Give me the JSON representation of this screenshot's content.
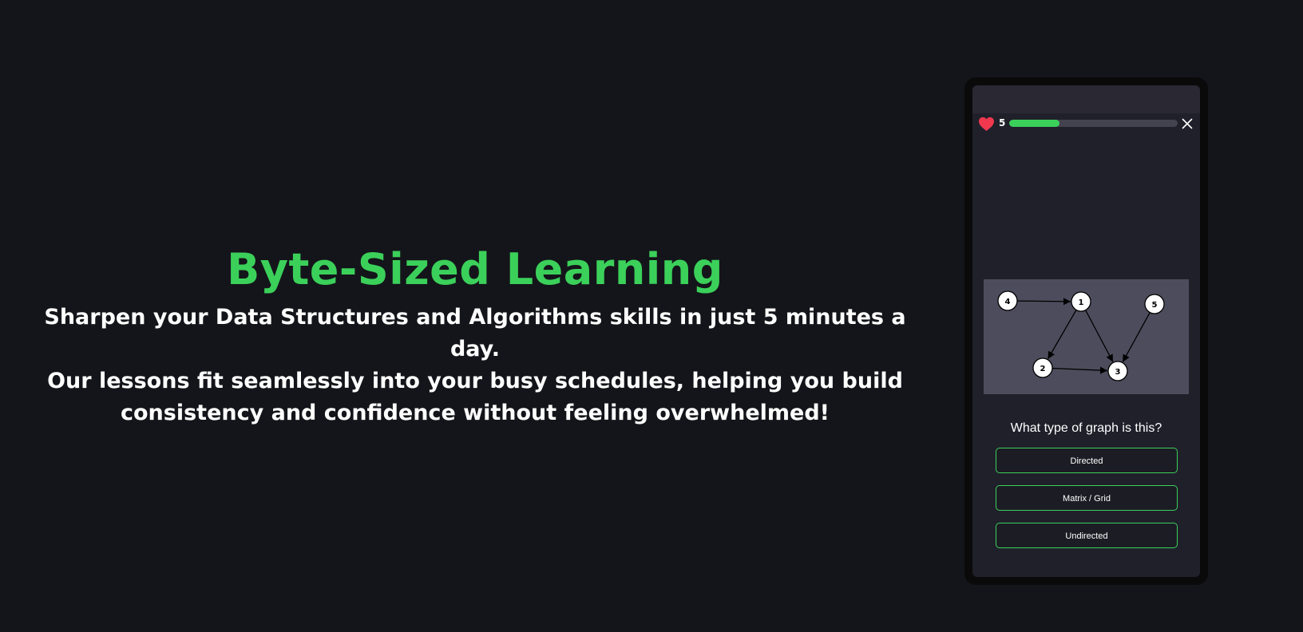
{
  "hero": {
    "title": "Byte-Sized Learning",
    "subtitle_lines": [
      "Sharpen your Data Structures and Algorithms skills in just 5 minutes a day.",
      "Our lessons fit seamlessly into your busy schedules, helping you build",
      "consistency and confidence without feeling overwhelmed!"
    ]
  },
  "lesson": {
    "lives": "5",
    "progress_fraction": 0.3,
    "graph": {
      "nodes": [
        "1",
        "2",
        "3",
        "4",
        "5"
      ],
      "edges": [
        [
          "4",
          "1"
        ],
        [
          "1",
          "2"
        ],
        [
          "1",
          "3"
        ],
        [
          "2",
          "3"
        ],
        [
          "5",
          "3"
        ]
      ]
    },
    "question": "What type of graph is this?",
    "answers": [
      "Directed",
      "Matrix / Grid",
      "Undirected"
    ]
  },
  "icons": {
    "lives": "heart-icon",
    "close": "close-icon"
  },
  "colors": {
    "accent": "#3bd05a",
    "heart": "#f0384f",
    "background": "#14151a"
  }
}
